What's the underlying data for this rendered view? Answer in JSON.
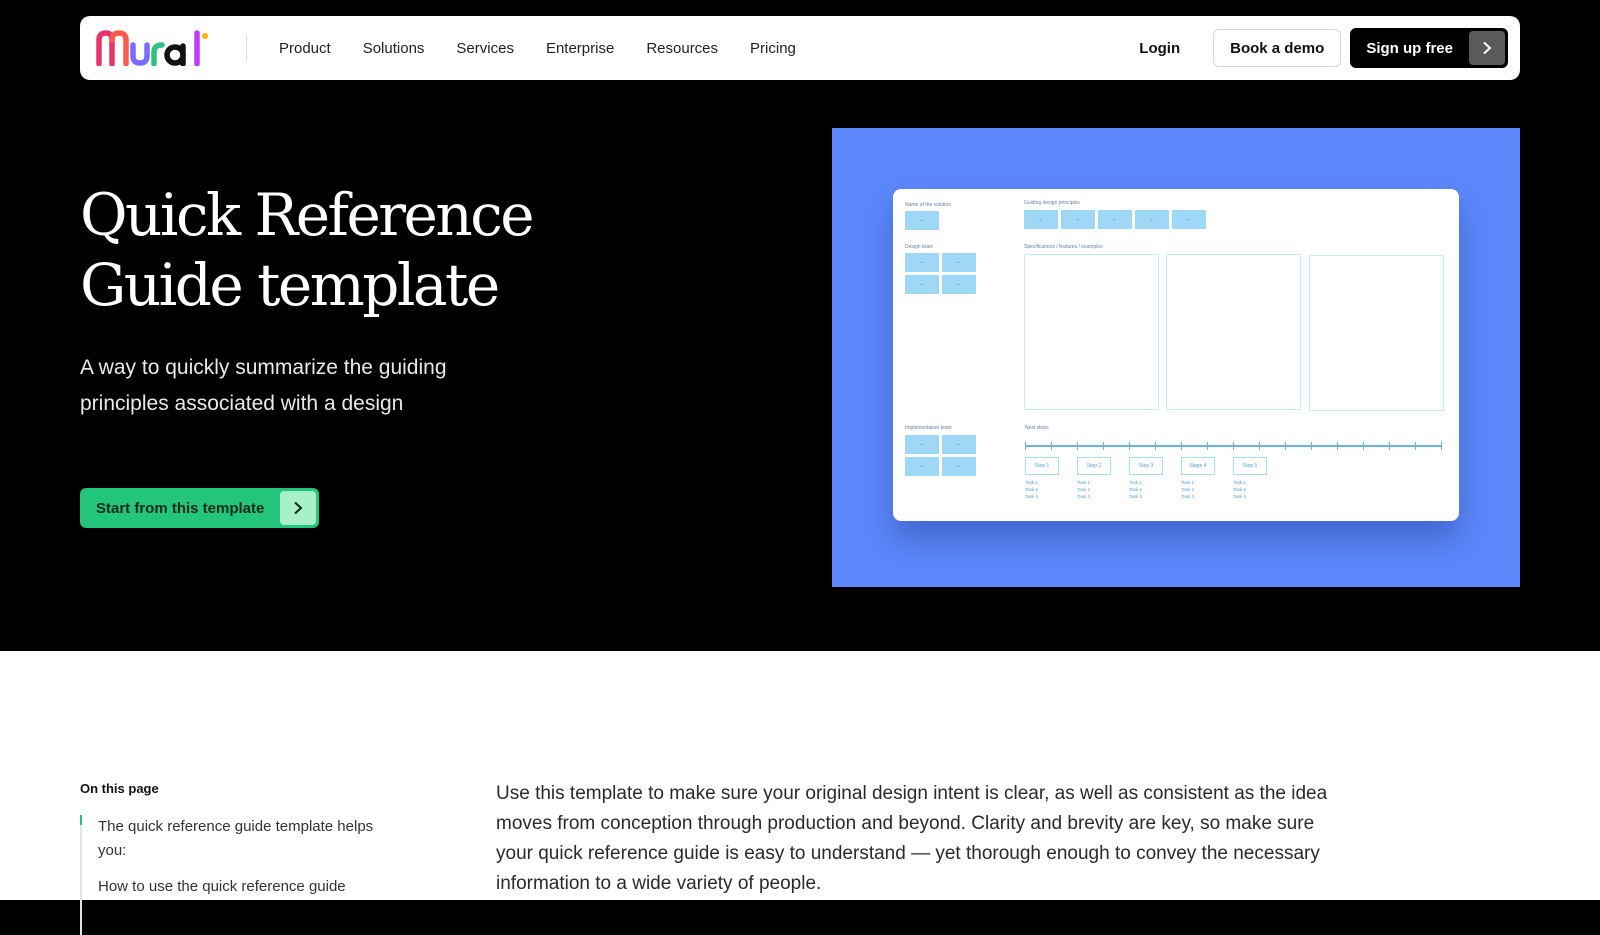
{
  "nav": {
    "logo_text": "Mural",
    "links": [
      "Product",
      "Solutions",
      "Services",
      "Enterprise",
      "Resources",
      "Pricing"
    ],
    "login": "Login",
    "book_demo": "Book a demo",
    "sign_up": "Sign up free",
    "sign_up_icon": "chevron-right-icon"
  },
  "hero": {
    "title_line1": "Quick Reference",
    "title_line2": "Guide template",
    "subtitle_line1": "A way to quickly summarize the guiding",
    "subtitle_line2": "principles associated with a design",
    "cta": "Start from this template",
    "cta_icon": "chevron-right-icon"
  },
  "preview": {
    "background": "#5c88fb",
    "labels": {
      "name": "Name of the solution",
      "principles": "Guiding design principles",
      "design_team": "Design team",
      "specs": "Specifications / features / examples",
      "impl_team": "Implementation team",
      "next_steps": "Next steps"
    },
    "steps": [
      "Step 1",
      "Step 2",
      "Step 3",
      "Steps 4",
      "Step 5"
    ],
    "tasks": [
      [
        "Task 1",
        "Task 2",
        "Task 3"
      ],
      [
        "Task 1",
        "Task 2",
        "Task 3"
      ],
      [
        "Task 1",
        "Task 2",
        "Task 3"
      ],
      [
        "Task 1",
        "Task 2",
        "Task 3"
      ],
      [
        "Task 1",
        "Task 2",
        "Task 3"
      ]
    ]
  },
  "content": {
    "toc_heading": "On this page",
    "toc_items": [
      "The quick reference guide template helps you:",
      "How to use the quick reference guide"
    ],
    "body": "Use this template to make sure your original design intent is clear, as well as consistent as the idea moves from conception through production and beyond. Clarity and brevity are key, so make sure your quick reference guide is easy to understand — yet thorough enough to convey the necessary information to a wide variety of people."
  },
  "colors": {
    "accent_green": "#22c57a",
    "hero_bg": "#000000",
    "preview_bg": "#5c88fb",
    "sticky_blue": "#9fd7f7"
  }
}
